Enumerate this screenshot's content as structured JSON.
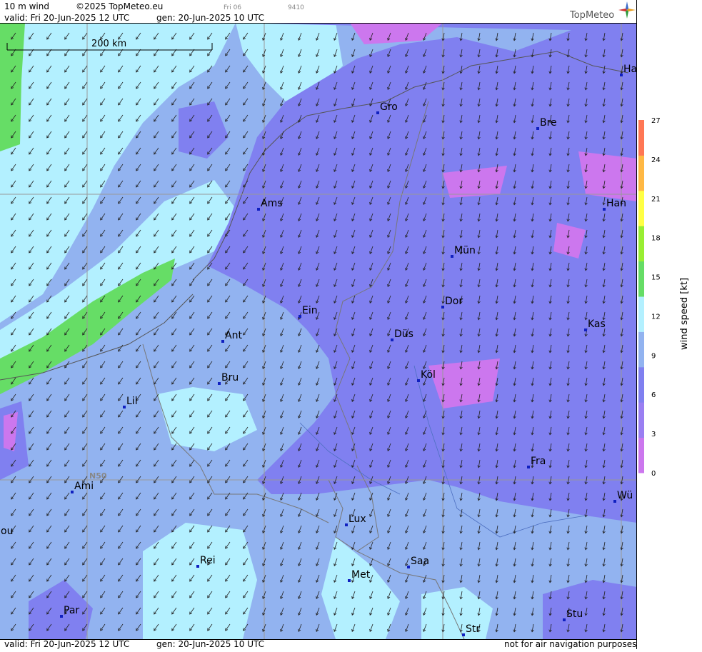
{
  "header": {
    "title": "10 m wind",
    "copyright": "©2025 TopMeteo.eu",
    "step_label": "Fri 06",
    "run_code": "9410",
    "valid": "valid:  Fri  20-Jun-2025  12 UTC",
    "generated": "gen: 20-Jun-2025 10 UTC",
    "brand": "TopMeteo"
  },
  "footer": {
    "valid": "valid:  Fri  20-Jun-2025  12 UTC",
    "generated": "gen: 20-Jun-2025 10 UTC",
    "disclaimer": "not for air navigation purposes"
  },
  "map": {
    "scale_label": "200 km",
    "latitude_label": "N50",
    "cities": [
      {
        "name": "Ha"
      },
      {
        "name": "Gro"
      },
      {
        "name": "Bre"
      },
      {
        "name": "Ams"
      },
      {
        "name": "Han"
      },
      {
        "name": "Mün"
      },
      {
        "name": "Ein"
      },
      {
        "name": "Dor"
      },
      {
        "name": "Ant"
      },
      {
        "name": "Düs"
      },
      {
        "name": "Kas"
      },
      {
        "name": "Bru"
      },
      {
        "name": "Köl"
      },
      {
        "name": "Lil"
      },
      {
        "name": "Fra"
      },
      {
        "name": "Ami"
      },
      {
        "name": "Wü"
      },
      {
        "name": "Lux"
      },
      {
        "name": "ou"
      },
      {
        "name": "Rei"
      },
      {
        "name": "Saa"
      },
      {
        "name": "Met"
      },
      {
        "name": "Par"
      },
      {
        "name": "Stu"
      },
      {
        "name": "Str"
      }
    ]
  },
  "legend": {
    "title": "wind  speed  [kt]",
    "ticks": [
      "27",
      "24",
      "21",
      "18",
      "15",
      "12",
      "9",
      "6",
      "3",
      "0"
    ],
    "bands": [
      "#cc77ee",
      "#9a7ff2",
      "#8080f0",
      "#92b3f0",
      "#b3f0ff",
      "#66dd66",
      "#99ee33",
      "#ffff44",
      "#ffb844",
      "#ff7755"
    ]
  }
}
